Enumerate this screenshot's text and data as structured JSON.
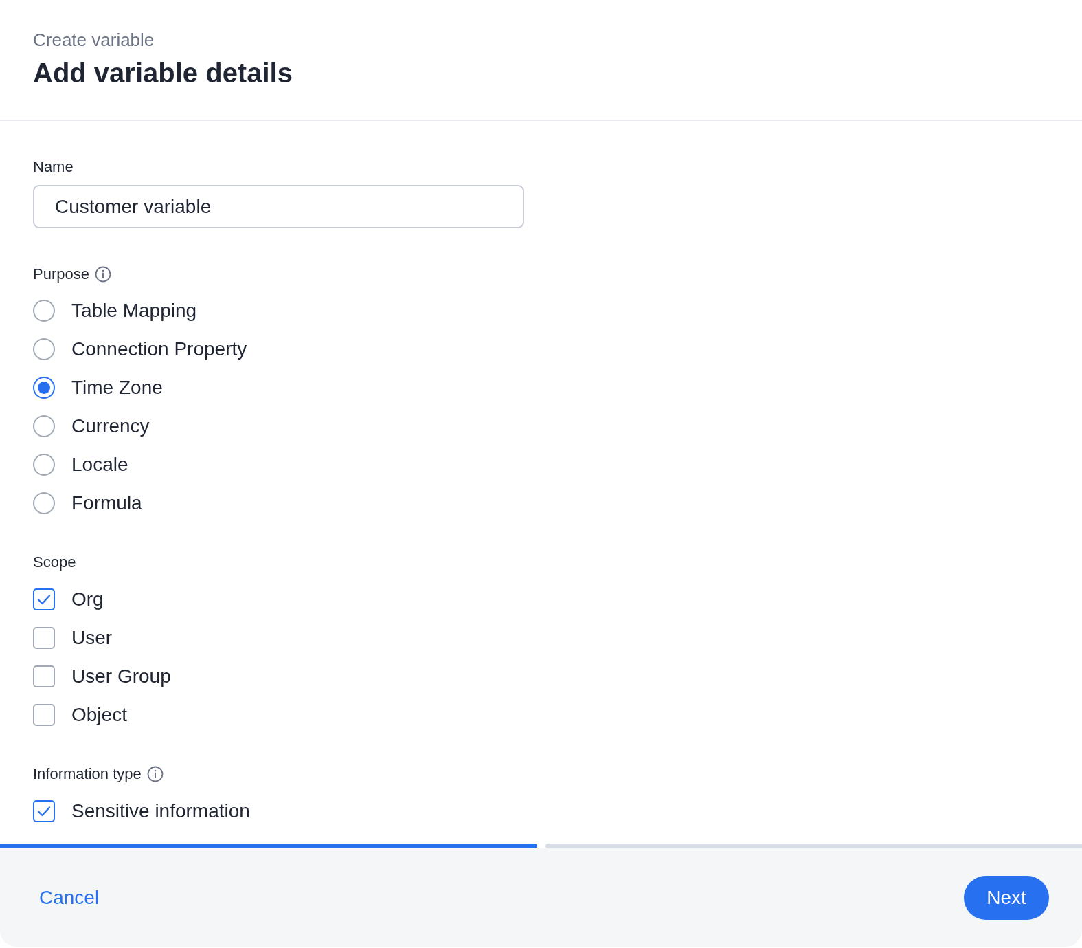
{
  "header": {
    "subtitle": "Create variable",
    "title": "Add variable details"
  },
  "form": {
    "name": {
      "label": "Name",
      "value": "Customer variable"
    },
    "purpose": {
      "label": "Purpose",
      "info_icon": true,
      "options": [
        {
          "label": "Table Mapping",
          "selected": false
        },
        {
          "label": "Connection Property",
          "selected": false
        },
        {
          "label": "Time Zone",
          "selected": true
        },
        {
          "label": "Currency",
          "selected": false
        },
        {
          "label": "Locale",
          "selected": false
        },
        {
          "label": "Formula",
          "selected": false
        }
      ]
    },
    "scope": {
      "label": "Scope",
      "options": [
        {
          "label": "Org",
          "checked": true
        },
        {
          "label": "User",
          "checked": false
        },
        {
          "label": "User Group",
          "checked": false
        },
        {
          "label": "Object",
          "checked": false
        }
      ]
    },
    "information_type": {
      "label": "Information type",
      "info_icon": true,
      "options": [
        {
          "label": "Sensitive information",
          "checked": true
        }
      ]
    }
  },
  "progress": {
    "steps": [
      {
        "done": true
      },
      {
        "done": false
      }
    ]
  },
  "footer": {
    "cancel": "Cancel",
    "next": "Next"
  }
}
